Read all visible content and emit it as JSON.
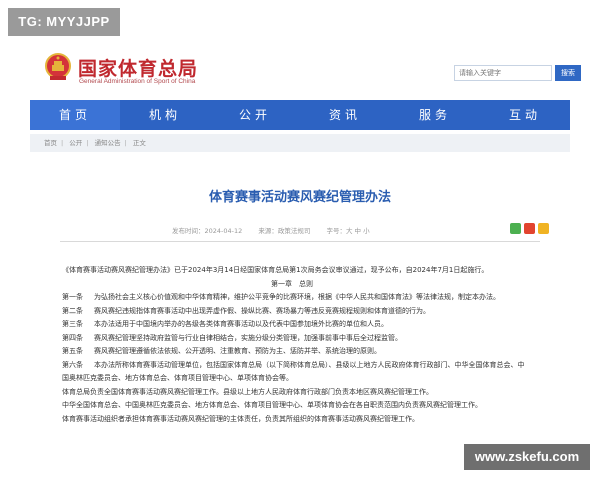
{
  "watermark_top": "TG: MYYJJPP",
  "watermark_bottom": "www.zskefu.com",
  "header": {
    "title_cn": "国家体育总局",
    "title_en": "General Administration of Sport of China",
    "search_placeholder": "请输入关键字",
    "search_button": "搜索"
  },
  "nav": [
    "首页",
    "机构",
    "公开",
    "资讯",
    "服务",
    "互动"
  ],
  "breadcrumb": [
    "首页",
    "公开",
    "通知公告",
    "正文"
  ],
  "article": {
    "title": "体育赛事活动赛风赛纪管理办法",
    "date": "发布时间：2024-04-12",
    "source": "来源：政策法规司",
    "font_size": "字号：大 中 小"
  },
  "body": {
    "intro": "《体育赛事活动赛风赛纪管理办法》已于2024年3月14日经国家体育总局第1次局务会议审议通过，现予公布，自2024年7月1日起施行。",
    "chapter": "第一章　总则",
    "articles": [
      {
        "label": "第一条",
        "text": "为弘扬社会主义核心价值观和中华体育精神，维护公平竞争的比赛环境，根据《中华人民共和国体育法》等法律法规，制定本办法。"
      },
      {
        "label": "第二条",
        "text": "赛风赛纪违规指体育赛事活动中出现弄虚作假、操纵比赛、赛场暴力等违反竞赛规程规则和体育道德的行为。"
      },
      {
        "label": "第三条",
        "text": "本办法适用于中国境内举办的各级各类体育赛事活动以及代表中国参加境外比赛的单位和人员。"
      },
      {
        "label": "第四条",
        "text": "赛风赛纪管理坚持政府监管与行业自律相结合，实施分级分类管理，加强事前事中事后全过程监管。"
      },
      {
        "label": "第五条",
        "text": "赛风赛纪管理遵循依法依规、公开透明、注重教育、预防为主、惩防并举、系统治理的原则。"
      },
      {
        "label": "第六条",
        "text": "本办法所称体育赛事活动管理单位，包括国家体育总局（以下简称体育总局）、县级以上地方人民政府体育行政部门、中华全国体育总会、中"
      }
    ],
    "continuation": "国奥林匹克委员会、地方体育总会、体育项目管理中心、单项体育协会等。",
    "para1": "体育总局负责全国体育赛事活动赛风赛纪管理工作。县级以上地方人民政府体育行政部门负责本地区赛风赛纪管理工作。",
    "para2": "中华全国体育总会、中国奥林匹克委员会、地方体育总会、体育项目管理中心、单项体育协会在各自职责范围内负责赛风赛纪管理工作。",
    "para3": "体育赛事活动组织者承担体育赛事活动赛风赛纪管理的主体责任，负责其所组织的体育赛事活动赛风赛纪管理工作。"
  },
  "colors": {
    "brand_red": "#c0282e",
    "nav_blue": "#2d63c3",
    "title_blue": "#2a5db0"
  }
}
